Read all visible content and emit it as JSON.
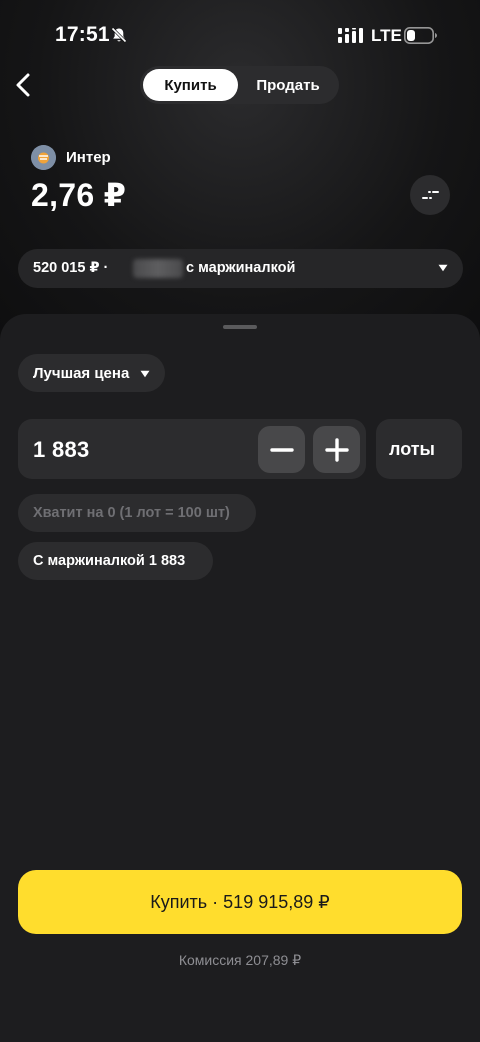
{
  "status_bar": {
    "time": "17:51",
    "network": "LTE"
  },
  "header": {
    "tabs": [
      {
        "label": "Купить",
        "active": true
      },
      {
        "label": "Продать",
        "active": false
      }
    ]
  },
  "instrument": {
    "name": "Интер",
    "price": "2,76 ₽"
  },
  "account": {
    "balance": "520 015 ₽ ·",
    "suffix": "с маржиналкой"
  },
  "order": {
    "price_type": "Лучшая цена",
    "quantity": "1 883",
    "unit": "лоты",
    "enough_hint": "Хватит на 0 (1 лот = 100 шт)",
    "margin_hint": "С маржиналкой 1 883"
  },
  "buy_button": {
    "label": "Купить · 519 915,89 ₽"
  },
  "commission": "Комиссия 207,89 ₽",
  "colors": {
    "accent": "#ffdd2d",
    "background": "#1d1d1f",
    "surface": "#2c2c2e",
    "muted_text": "#8e8e93"
  }
}
